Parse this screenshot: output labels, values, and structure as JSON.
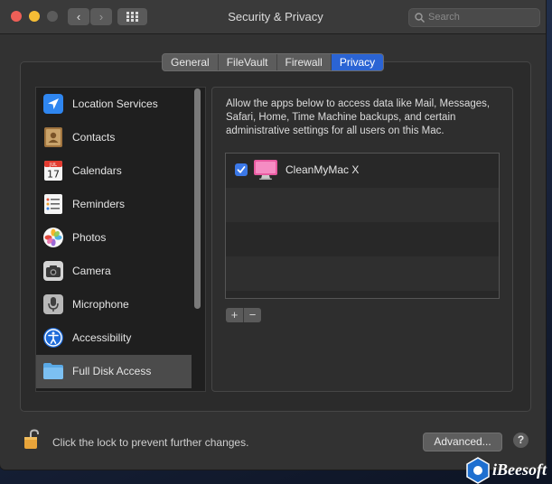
{
  "window": {
    "title": "Security & Privacy"
  },
  "titlebar": {
    "back_label": "‹",
    "forward_label": "›",
    "search_placeholder": "Search"
  },
  "tabs": [
    {
      "label": "General",
      "active": false
    },
    {
      "label": "FileVault",
      "active": false
    },
    {
      "label": "Firewall",
      "active": false
    },
    {
      "label": "Privacy",
      "active": true
    }
  ],
  "sidebar": {
    "items": [
      {
        "label": "Location Services",
        "icon": "location-icon"
      },
      {
        "label": "Contacts",
        "icon": "contacts-icon"
      },
      {
        "label": "Calendars",
        "icon": "calendar-icon"
      },
      {
        "label": "Reminders",
        "icon": "reminders-icon"
      },
      {
        "label": "Photos",
        "icon": "photos-icon"
      },
      {
        "label": "Camera",
        "icon": "camera-icon"
      },
      {
        "label": "Microphone",
        "icon": "microphone-icon"
      },
      {
        "label": "Accessibility",
        "icon": "accessibility-icon"
      },
      {
        "label": "Full Disk Access",
        "icon": "folder-icon",
        "selected": true
      }
    ]
  },
  "calendar_icon": {
    "month": "JUL",
    "day": "17"
  },
  "main": {
    "description": "Allow the apps below to access data like Mail, Messages, Safari, Home, Time Machine backups, and certain administrative settings for all users on this Mac.",
    "apps": [
      {
        "name": "CleanMyMac X",
        "checked": true
      }
    ],
    "add_label": "+",
    "remove_label": "−"
  },
  "footer": {
    "lock_text": "Click the lock to prevent further changes.",
    "advanced_label": "Advanced...",
    "help_label": "?"
  },
  "watermark": {
    "text": "iBeesoft"
  },
  "colors": {
    "accent": "#2b64d4",
    "checkbox": "#3b78e7"
  }
}
